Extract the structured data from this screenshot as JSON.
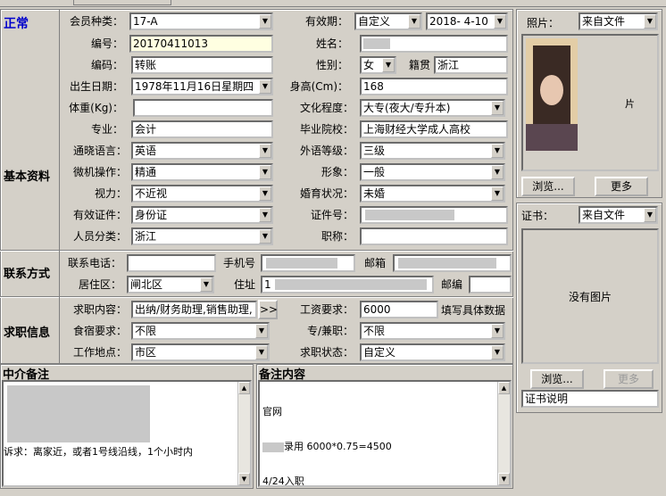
{
  "status": "正常",
  "sections": {
    "basic": "基本资料",
    "contact": "联系方式",
    "job": "求职信息",
    "agency_notes": "中介备注",
    "remarks": "备注内容"
  },
  "labels": {
    "member_type": "会员种类：",
    "validity": "有效期：",
    "number": "编号：",
    "name": "姓名：",
    "code": "编码：",
    "gender": "性别：",
    "native": "籍贯",
    "birth": "出生日期：",
    "height": "身高(Cm)：",
    "weight": "体重(Kg)：",
    "education": "文化程度：",
    "major": "专业：",
    "school": "毕业院校：",
    "language": "通晓语言：",
    "foreign_level": "外语等级：",
    "computer": "微机操作：",
    "appearance": "形象：",
    "vision": "视力：",
    "marital": "婚育状况：",
    "id_type": "有效证件：",
    "id_no": "证件号：",
    "category": "人员分类：",
    "title": "职称：",
    "phone": "联系电话：",
    "mobile": "手机号",
    "email": "邮箱",
    "district": "居住区：",
    "address": "住址",
    "postcode": "邮编",
    "job_content": "求职内容：",
    "salary": "工资要求：",
    "salary_note": "填写具体数据",
    "board": "食宿要求：",
    "fulltime": "专/兼职：",
    "workplace": "工作地点：",
    "job_status": "求职状态：",
    "photo": "照片：",
    "certificate": "证书："
  },
  "values": {
    "member_type": "17-A",
    "validity_type": "自定义",
    "validity_date": "2018- 4-10",
    "number": "20170411013",
    "code": "转账",
    "gender": "女",
    "native": "浙江",
    "birth": "1978年11月16日星期四",
    "height": "168",
    "weight": "",
    "education": "大专(夜大/专升本)",
    "major": "会计",
    "school": "上海财经大学成人高校",
    "language": "英语",
    "foreign_level": "三级",
    "computer": "精通",
    "appearance": "一般",
    "vision": "不近视",
    "marital": "未婚",
    "id_type": "身份证",
    "category": "浙江",
    "title": "",
    "phone": "",
    "district": "闸北区",
    "address": "1",
    "postcode": "",
    "job_content": "出纳/财务助理,销售助理,",
    "salary": "6000",
    "board": "不限",
    "fulltime": "不限",
    "workplace": "市区",
    "job_status": "自定义",
    "photo_source": "来自文件",
    "cert_source": "来自文件",
    "cert_desc": "证书说明",
    "no_picture": "没有图片"
  },
  "buttons": {
    "more_arrow": ">>",
    "browse": "浏览...",
    "more": "更多"
  },
  "notes": {
    "agency_text": "诉求：离家近，或者1号线沿线，1个小时内",
    "remarks_line1": "官网",
    "remarks_line2": "录用 6000*0.75=4500",
    "remarks_line3": "4/24入职"
  }
}
